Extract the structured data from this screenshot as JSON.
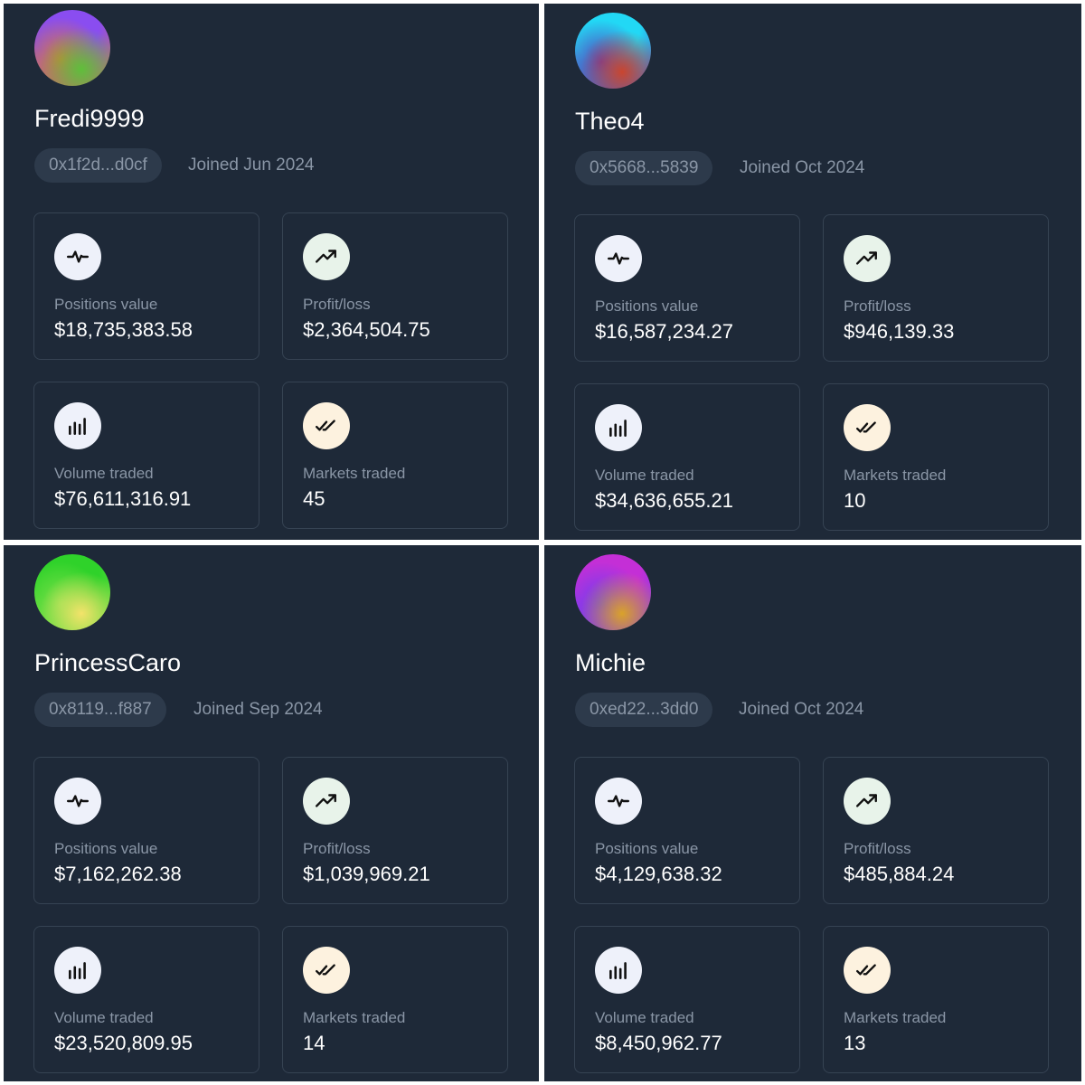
{
  "colors": {
    "panel_background": "#1e2938",
    "card_border": "#364353",
    "address_pill": "#2d3a4b",
    "muted_text": "#8a96a6",
    "primary_text": "#ffffff"
  },
  "icons": {
    "positions": "activity-pulse-icon",
    "profit": "trending-up-icon",
    "volume": "bar-chart-icon",
    "markets": "double-check-icon"
  },
  "profiles": [
    {
      "username": "Fredi9999",
      "address": "0x1f2d...d0cf",
      "joined": "Joined Jun 2024",
      "avatar_gradient": [
        "#8a4df0",
        "#d77a3a",
        "#5fbf3a"
      ],
      "stats": {
        "positions_label": "Positions value",
        "positions_value": "$18,735,383.58",
        "profit_label": "Profit/loss",
        "profit_value": "$2,364,504.75",
        "volume_label": "Volume traded",
        "volume_value": "$76,611,316.91",
        "markets_label": "Markets traded",
        "markets_value": "45"
      }
    },
    {
      "username": "Theo4",
      "address": "0x5668...5839",
      "joined": "Joined Oct 2024",
      "avatar_gradient": [
        "#22d8f5",
        "#5a3db8",
        "#c9452f"
      ],
      "stats": {
        "positions_label": "Positions value",
        "positions_value": "$16,587,234.27",
        "profit_label": "Profit/loss",
        "profit_value": "$946,139.33",
        "volume_label": "Volume traded",
        "volume_value": "$34,636,655.21",
        "markets_label": "Markets traded",
        "markets_value": "10"
      }
    },
    {
      "username": "PrincessCaro",
      "address": "0x8119...f887",
      "joined": "Joined Sep 2024",
      "avatar_gradient": [
        "#2fd22a",
        "#7de04a",
        "#f3e36a"
      ],
      "stats": {
        "positions_label": "Positions value",
        "positions_value": "$7,162,262.38",
        "profit_label": "Profit/loss",
        "profit_value": "$1,039,969.21",
        "volume_label": "Volume traded",
        "volume_value": "$23,520,809.95",
        "markets_label": "Markets traded",
        "markets_value": "14"
      }
    },
    {
      "username": "Michie",
      "address": "0xed22...3dd0",
      "joined": "Joined Oct 2024",
      "avatar_gradient": [
        "#c42fd6",
        "#6b3ff0",
        "#d9a22a"
      ],
      "stats": {
        "positions_label": "Positions value",
        "positions_value": "$4,129,638.32",
        "profit_label": "Profit/loss",
        "profit_value": "$485,884.24",
        "volume_label": "Volume traded",
        "volume_value": "$8,450,962.77",
        "markets_label": "Markets traded",
        "markets_value": "13"
      }
    }
  ]
}
